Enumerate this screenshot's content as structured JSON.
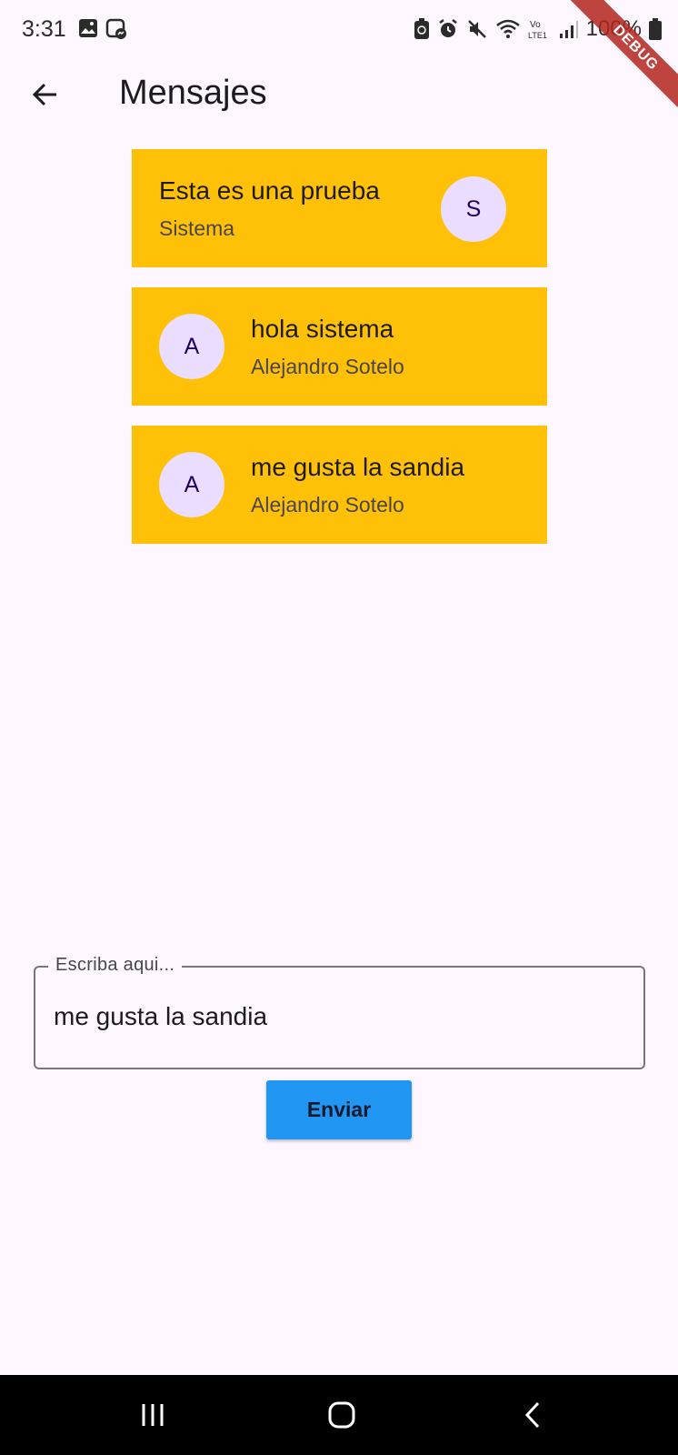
{
  "status_bar": {
    "time": "3:31",
    "battery": "100%",
    "left_icons": [
      "image-icon",
      "messenger-icon"
    ],
    "right_icons": [
      "recycle-icon",
      "alarm-icon",
      "mute-icon",
      "wifi-icon",
      "volte-icon",
      "signal-icon",
      "battery-icon"
    ]
  },
  "debug_banner": "DEBUG",
  "app_bar": {
    "title": "Mensajes"
  },
  "messages": [
    {
      "text": "Esta es una prueba",
      "author": "Sistema",
      "avatar": "S",
      "align": "right"
    },
    {
      "text": "hola sistema",
      "author": "Alejandro Sotelo",
      "avatar": "A",
      "align": "left"
    },
    {
      "text": "me gusta la sandia",
      "author": "Alejandro Sotelo",
      "avatar": "A",
      "align": "left"
    }
  ],
  "composer": {
    "label": "Escriba aqui...",
    "value": "me gusta la sandia",
    "send_label": "Enviar"
  },
  "colors": {
    "background": "#fef7ff",
    "card": "#ffc107",
    "avatar_bg": "#eaddff",
    "send_button": "#2196f3"
  }
}
